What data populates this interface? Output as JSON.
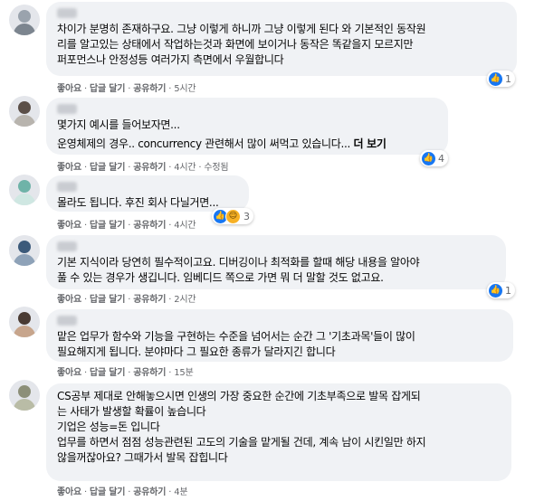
{
  "comments": [
    {
      "lines": [
        "차이가 분명히 존재하구요. 그냥 이렇게 하니까 그냥 이렇게 된다 와 기본적인 동작원",
        "리를 알고있는 상태에서 작업하는것과 화면에 보이거나 동작은 똑같을지 모르지만",
        "퍼포먼스나 안정성등 여러가지 측면에서 우월합니다"
      ],
      "reaction_count": "1",
      "like": "좋아요",
      "reply": "답글 달기",
      "share": "공유하기",
      "time": "5시간"
    },
    {
      "lines": [
        "몇가지 예시를 들어보자면...",
        "",
        "운영체제의 경우.. concurrency 관련해서 많이 써먹고 있습니다..."
      ],
      "more": "더 보기",
      "reaction_count": "4",
      "like": "좋아요",
      "reply": "답글 달기",
      "share": "공유하기",
      "time": "4시간",
      "edited": "수정됨"
    },
    {
      "lines": [
        "몰라도 됩니다. 후진 회사 다닐거면..."
      ],
      "reaction_count": "3",
      "like": "좋아요",
      "reply": "답글 달기",
      "share": "공유하기",
      "time": "4시간"
    },
    {
      "lines": [
        "기본 지식이라 당연히 필수적이고요. 디버깅이나 최적화를 할때 해당 내용을 알아야",
        "풀 수 있는 경우가 생깁니다. 임베디드 쪽으로 가면 뭐 더 말할 것도 없고요."
      ],
      "reaction_count": "1",
      "like": "좋아요",
      "reply": "답글 달기",
      "share": "공유하기",
      "time": "2시간"
    },
    {
      "lines": [
        "맡은 업무가 함수와 기능을 구현하는 수준을 넘어서는 순간 그 '기초과목'들이 많이",
        "필요해지게 됩니다. 분야마다 그 필요한 종류가 달라지긴 합니다"
      ],
      "like": "좋아요",
      "reply": "답글 달기",
      "share": "공유하기",
      "time": "15분"
    },
    {
      "lines": [
        "CS공부 제대로 안해놓으시면 인생의 가장 중요한 순간에 기초부족으로 발목 잡게되",
        "는 사태가 발생할 확률이 높습니다",
        "기업은 성능=돈 입니다",
        "업무를 하면서 점점 성능관련된 고도의 기술을 맡게될 건데, 계속 남이 시킨일만 하지",
        "않을꺼잖아요? 그때가서 발목 잡힙니다"
      ],
      "like": "좋아요",
      "reply": "답글 달기",
      "share": "공유하기",
      "time": "4분"
    }
  ],
  "colors": {
    "bubble": "#f0f2f5",
    "meta": "#65676b",
    "like_blue": "#1877f2"
  },
  "icons": [
    "like-icon",
    "love-icon",
    "wow-icon"
  ]
}
